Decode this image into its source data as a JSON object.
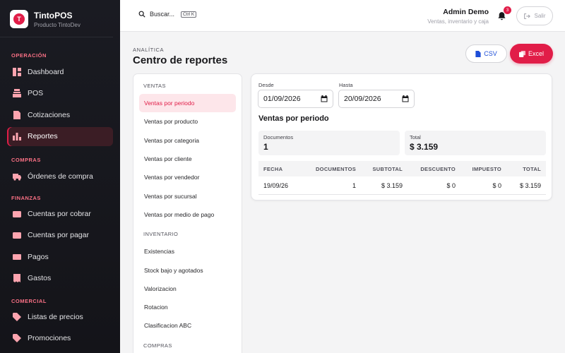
{
  "brand": {
    "title": "TintoPOS",
    "subtitle": "Producto TintoDev",
    "logo_letter": "T"
  },
  "sidebar": {
    "sections": [
      {
        "label": "Operación",
        "items": [
          {
            "label": "Dashboard",
            "icon": "dashboard-icon",
            "active": false
          },
          {
            "label": "POS",
            "icon": "register-icon",
            "active": false
          },
          {
            "label": "Cotizaciones",
            "icon": "document-icon",
            "active": false
          },
          {
            "label": "Reportes",
            "icon": "bar-chart-icon",
            "active": true
          }
        ]
      },
      {
        "label": "Compras",
        "items": [
          {
            "label": "Órdenes de compra",
            "icon": "truck-icon",
            "active": false
          }
        ]
      },
      {
        "label": "Finanzas",
        "items": [
          {
            "label": "Cuentas por cobrar",
            "icon": "wallet-icon",
            "active": false
          },
          {
            "label": "Cuentas por pagar",
            "icon": "wallet-out-icon",
            "active": false
          },
          {
            "label": "Pagos",
            "icon": "money-icon",
            "active": false
          },
          {
            "label": "Gastos",
            "icon": "receipt-icon",
            "active": false
          }
        ]
      },
      {
        "label": "Comercial",
        "items": [
          {
            "label": "Listas de precios",
            "icon": "tag-icon",
            "active": false
          },
          {
            "label": "Promociones",
            "icon": "tag-icon",
            "active": false
          }
        ]
      }
    ]
  },
  "topbar": {
    "search_label": "Buscar...",
    "search_shortcut": "Ctrl K",
    "user_name": "Admin Demo",
    "user_subtitle": "Ventas, inventario y caja",
    "notifications_count": "3",
    "logout_label": "Salir"
  },
  "header": {
    "eyebrow": "ANALÍTICA",
    "title": "Centro de reportes",
    "csv_label": "CSV",
    "excel_label": "Excel"
  },
  "reports": {
    "groups": [
      {
        "label": "Ventas",
        "items": [
          {
            "label": "Ventas por periodo",
            "active": true
          },
          {
            "label": "Ventas por producto",
            "active": false
          },
          {
            "label": "Ventas por categoria",
            "active": false
          },
          {
            "label": "Ventas por cliente",
            "active": false
          },
          {
            "label": "Ventas por vendedor",
            "active": false
          },
          {
            "label": "Ventas por sucursal",
            "active": false
          },
          {
            "label": "Ventas por medio de pago",
            "active": false
          }
        ]
      },
      {
        "label": "Inventario",
        "items": [
          {
            "label": "Existencias",
            "active": false
          },
          {
            "label": "Stock bajo y agotados",
            "active": false
          },
          {
            "label": "Valorizacion",
            "active": false
          },
          {
            "label": "Rotacion",
            "active": false
          },
          {
            "label": "Clasificacion ABC",
            "active": false
          }
        ]
      },
      {
        "label": "Compras",
        "items": []
      }
    ]
  },
  "filters": {
    "from_label": "Desde",
    "from_value": "01/09/2026",
    "to_label": "Hasta",
    "to_value": "20/09/2026"
  },
  "report": {
    "title": "Ventas por periodo",
    "stats": [
      {
        "label": "Documentos",
        "value": "1"
      },
      {
        "label": "Total",
        "value": "$ 3.159"
      }
    ],
    "columns": [
      "FECHA",
      "DOCUMENTOS",
      "SUBTOTAL",
      "DESCUENTO",
      "IMPUESTO",
      "TOTAL"
    ],
    "rows": [
      [
        "19/09/26",
        "1",
        "$ 3.159",
        "$ 0",
        "$ 0",
        "$ 3.159"
      ]
    ]
  },
  "colors": {
    "accent": "#e11d48",
    "sidebar_bg": "#16171d",
    "link_blue": "#1d4ed8"
  }
}
